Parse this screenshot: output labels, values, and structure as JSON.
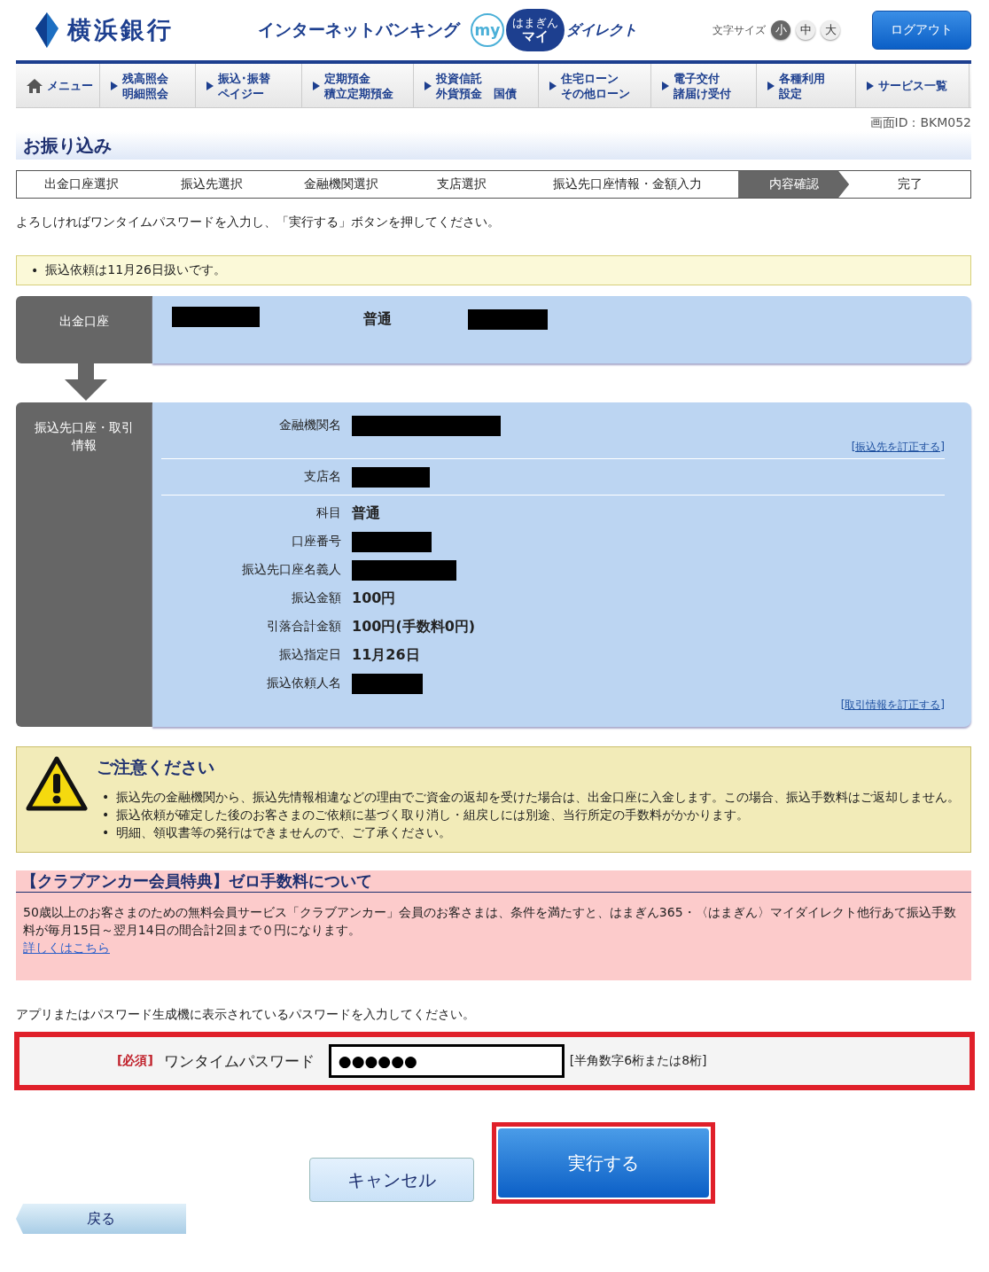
{
  "header": {
    "bank_name": "横浜銀行",
    "service": "インターネットバンキング",
    "brand_my": "my",
    "brand_small": "はまぎん",
    "brand_mai": "マイ",
    "brand_direct": "ダイレクト",
    "font_size_label": "文字サイズ",
    "font_sizes": [
      {
        "label": "小",
        "selected": true
      },
      {
        "label": "中",
        "selected": false
      },
      {
        "label": "大",
        "selected": false
      }
    ],
    "logout": "ログアウト"
  },
  "nav": [
    {
      "kind": "home",
      "lines": [
        "メニュー"
      ]
    },
    {
      "kind": "link",
      "lines": [
        "残高照会",
        "明細照会"
      ]
    },
    {
      "kind": "link",
      "lines": [
        "振込･振替",
        "ペイジー"
      ]
    },
    {
      "kind": "link",
      "lines": [
        "定期預金",
        "積立定期預金"
      ]
    },
    {
      "kind": "link",
      "lines": [
        "投資信託",
        "外貨預金　国債"
      ]
    },
    {
      "kind": "link",
      "lines": [
        "住宅ローン",
        "その他ローン"
      ]
    },
    {
      "kind": "link",
      "lines": [
        "電子交付",
        "諸届け受付"
      ]
    },
    {
      "kind": "link",
      "lines": [
        "各種利用",
        "設定"
      ]
    },
    {
      "kind": "link",
      "lines": [
        "サービス一覧"
      ]
    }
  ],
  "screen_id": "画面ID：BKM052",
  "page_title": "お振り込み",
  "steps": [
    {
      "label": "出金口座選択",
      "selected": false
    },
    {
      "label": "振込先選択",
      "selected": false
    },
    {
      "label": "金融機関選択",
      "selected": false
    },
    {
      "label": "支店選択",
      "selected": false
    },
    {
      "label": "振込先口座情報・金額入力",
      "selected": false
    },
    {
      "label": "内容確認",
      "selected": true
    },
    {
      "label": "完了",
      "selected": false
    }
  ],
  "instruction": "よろしければワンタイムパスワードを入力し、「実行する」ボタンを押してください。",
  "notice": {
    "bullet": "•",
    "text": "振込依頼は11月26日扱いです。"
  },
  "source": {
    "label": "出金口座",
    "account_type": "普通"
  },
  "destination": {
    "label": "振込先口座・取引情報",
    "groups": [
      {
        "rows": [
          {
            "label": "金融機関名",
            "kind": "redacted"
          }
        ],
        "link": "[振込先を訂正する]"
      },
      {
        "rows": [
          {
            "label": "支店名",
            "kind": "redacted"
          }
        ]
      },
      {
        "rows": [
          {
            "label": "科目",
            "kind": "text",
            "value": "普通"
          },
          {
            "label": "口座番号",
            "kind": "redacted"
          },
          {
            "label": "振込先口座名義人",
            "kind": "redacted"
          },
          {
            "label": "振込金額",
            "kind": "text",
            "value": "100円"
          },
          {
            "label": "引落合計金額",
            "kind": "text",
            "value": "100円(手数料0円)"
          },
          {
            "label": "振込指定日",
            "kind": "text",
            "value": "11月26日"
          },
          {
            "label": "振込依頼人名",
            "kind": "redacted"
          }
        ],
        "link": "[取引情報を訂正する]"
      }
    ]
  },
  "caution": {
    "title": "ご注意ください",
    "bullet": "•",
    "items": [
      "振込先の金融機関から、振込先情報相違などの理由でご資金の返却を受けた場合は、出金口座に入金します。この場合、振込手数料はご返却しません。",
      "振込依頼が確定した後のお客さまのご依頼に基づく取り消し・組戻しには別途、当行所定の手数料がかかります。",
      "明細、領収書等の発行はできませんので、ご了承ください。"
    ]
  },
  "promo": {
    "title": "【クラブアンカー会員特典】ゼロ手数料について",
    "text": "50歳以上のお客さまのための無料会員サービス「クラブアンカー」会員のお客さまは、条件を満たすと、はまぎん365・〈はまぎん〉マイダイレクト他行あて振込手数料が毎月15日～翌月14日の間合計2回まで０円になります。",
    "link": "詳しくはこちら"
  },
  "password_instruction": "アプリまたはパスワード生成機に表示されているパスワードを入力してください。",
  "password": {
    "required": "[必須]",
    "label": "ワンタイムパスワード",
    "value": "●●●●●●",
    "hint": "[半角数字6桁または8桁]"
  },
  "buttons": {
    "cancel": "キャンセル",
    "execute": "実行する",
    "back": "戻る"
  }
}
